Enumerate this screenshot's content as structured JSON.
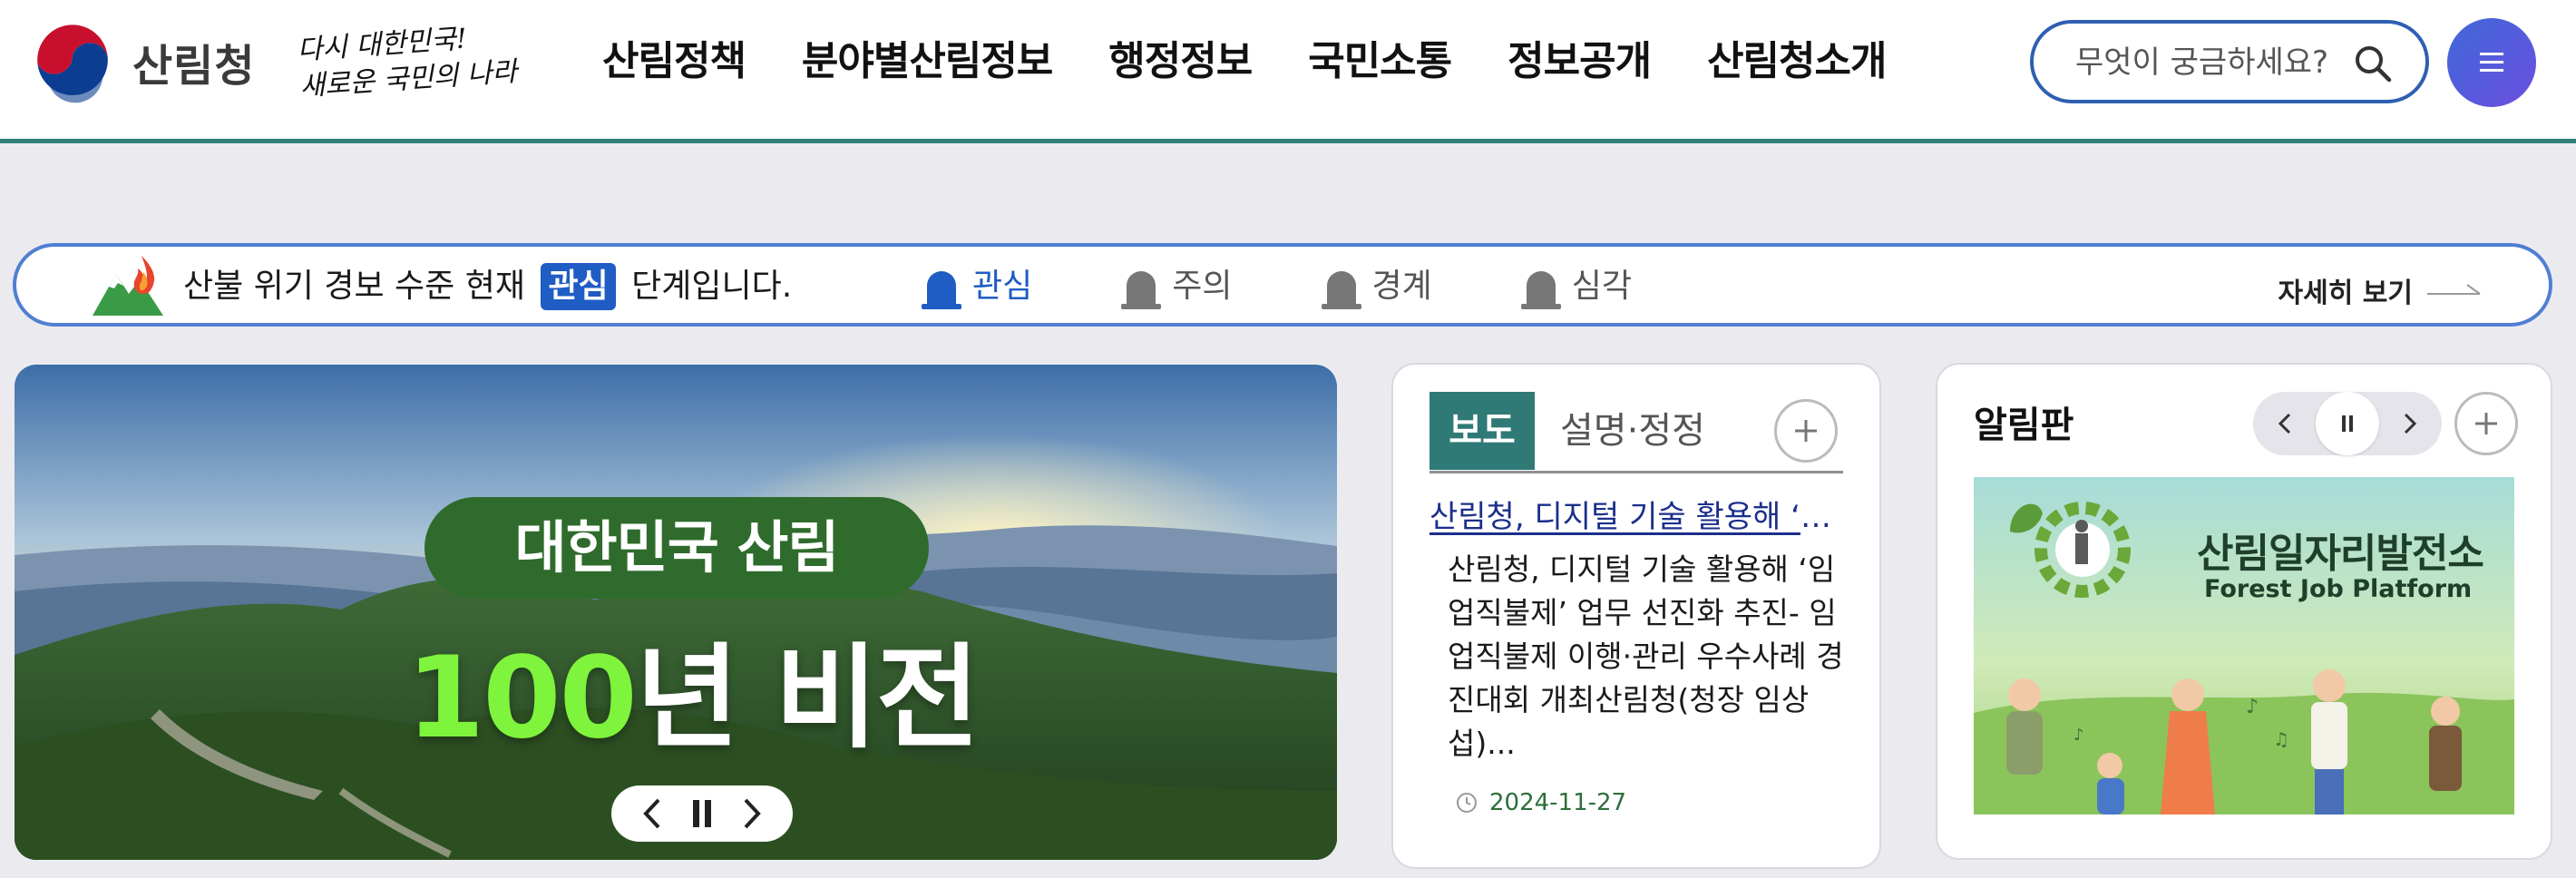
{
  "header": {
    "logo_text": "산림청",
    "slogan_line1": "다시 대한민국!",
    "slogan_line2": "새로운 국민의 나라",
    "nav": [
      "산림정책",
      "분야별산림정보",
      "행정정보",
      "국민소통",
      "정보공개",
      "산림청소개"
    ],
    "search_placeholder": "무엇이 궁금하세요?"
  },
  "alert": {
    "prefix": "산불 위기 경보 수준 현재",
    "current_level": "관심",
    "suffix": "단계입니다.",
    "levels": [
      "관심",
      "주의",
      "경계",
      "심각"
    ],
    "more_label": "자세히 보기",
    "active_color": "#1f5cc4"
  },
  "hero": {
    "pill_text": "대한민국 산림",
    "number": "100",
    "headline_rest": "년 비전"
  },
  "news": {
    "tab_active": "보도",
    "tab_inactive": "설명·정정",
    "title": "산림청, 디지털 기술 활용해 ‘임업직불제’ 업무 선진화 추진",
    "body": "산림청, 디지털 기술 활용해 ‘임업직불제’ 업무 선진화 추진- 임업직불제 이행·관리 우수사례 경진대회 개최산림청(청장 임상섭)...",
    "date": "2024-11-27",
    "accent": "#2f7a76"
  },
  "board": {
    "title": "알림판",
    "image_title": "산림일자리발전소",
    "image_subtitle": "Forest Job Platform"
  }
}
